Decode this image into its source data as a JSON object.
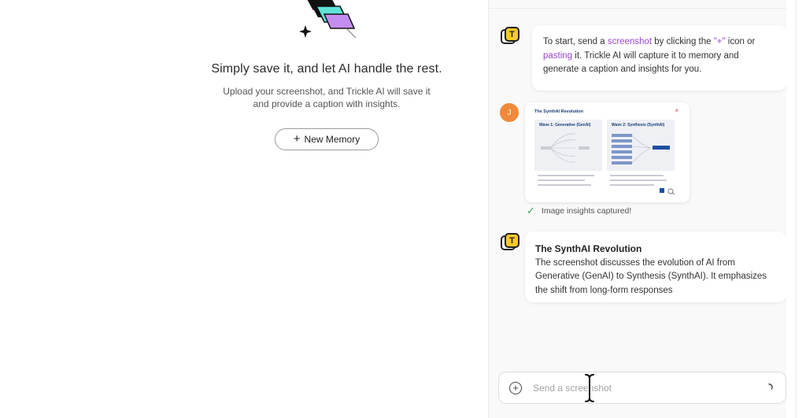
{
  "hero": {
    "title": "Simply save it, and let AI handle the rest.",
    "subtitle_line1": "Upload your screenshot, and Trickle AI will save it",
    "subtitle_line2": "and provide a caption with insights.",
    "new_memory_icon": "plus-icon",
    "new_memory_label": "New Memory"
  },
  "chat": {
    "bot_avatar_letter": "T",
    "user_avatar_letter": "J",
    "intro": {
      "t1": "To start, send a ",
      "link1": "screenshot",
      "t2": " by clicking the ",
      "link2": "\"+\"",
      "t3": " icon or ",
      "link3": "pasting",
      "t4": " it. Trickle AI will capture it to memory and generate a caption and insights for you."
    },
    "attachment": {
      "title": "The SynthAI Revolution",
      "close": "×",
      "col1_title": "Wave 1: Generative (GenAI)",
      "col2_title": "Wave 2: Synthesis (SynthAI)"
    },
    "status": "Image insights captured!",
    "reply": {
      "title": "The SynthAI Revolution",
      "body": "The screenshot discusses the evolution of AI from Generative (GenAI) to Synthesis (SynthAI). It emphasizes the shift from long-form responses"
    }
  },
  "composer": {
    "placeholder": "Send a screenshot",
    "add_icon": "plus-circle-icon",
    "send_icon": "spinner-icon"
  },
  "colors": {
    "accent_purple": "#9b45d6",
    "bot_yellow": "#f6c927",
    "user_orange": "#f08a3a",
    "success_green": "#3ba55c"
  }
}
